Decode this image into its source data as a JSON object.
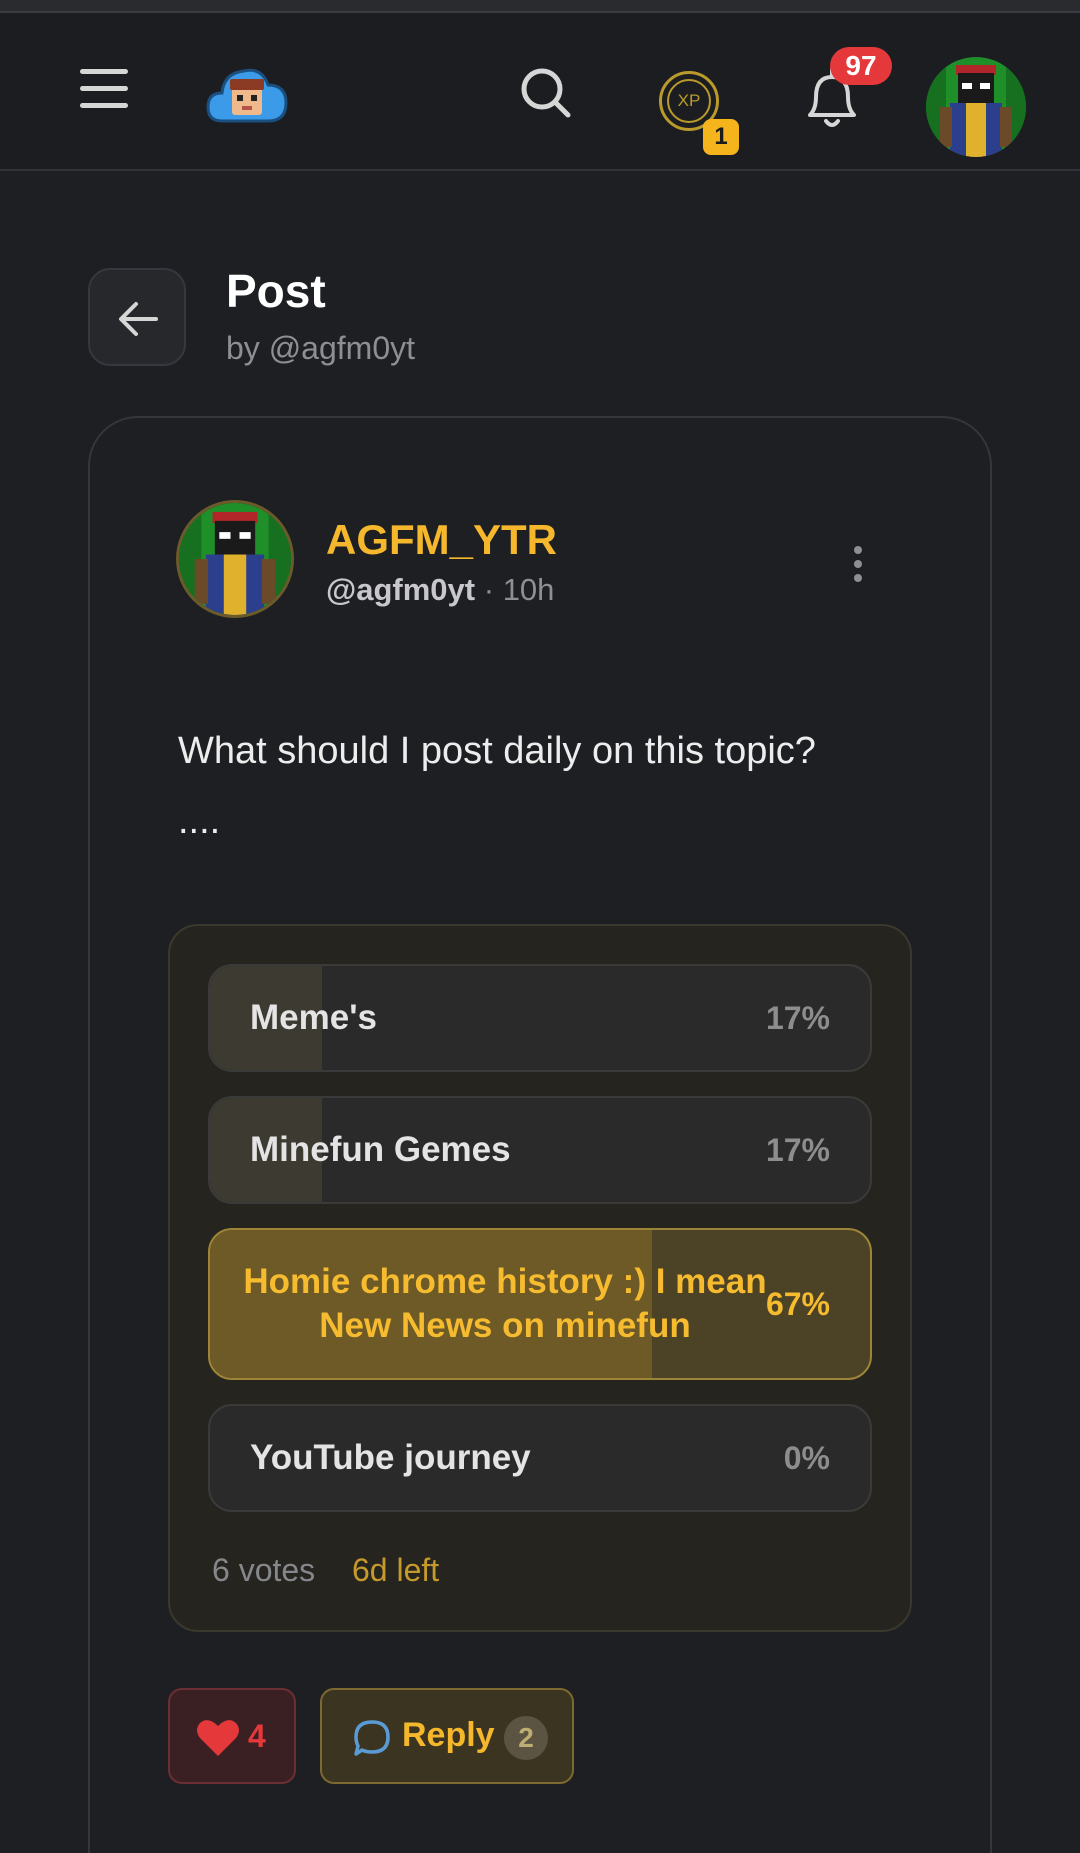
{
  "header": {
    "notifications_count": "97",
    "xp_label": "XP",
    "xp_count": "1"
  },
  "page": {
    "title": "Post",
    "subtitle": "by @agfm0yt"
  },
  "post": {
    "author_name": "AGFM_YTR",
    "author_handle": "@agfm0yt",
    "separator": "·",
    "time": "10h",
    "text_line1": "What should I post daily on this topic?",
    "text_line2": "...."
  },
  "poll": {
    "options": [
      {
        "label": "Meme's",
        "percent": "17%",
        "value": 17,
        "selected": false
      },
      {
        "label": "Minefun Gemes",
        "percent": "17%",
        "value": 17,
        "selected": false
      },
      {
        "label": "Homie chrome history :) I mean New News on minefun",
        "percent": "67%",
        "value": 67,
        "selected": true
      },
      {
        "label": "YouTube journey",
        "percent": "0%",
        "value": 0,
        "selected": false
      }
    ],
    "votes": "6 votes",
    "time_left": "6d left"
  },
  "actions": {
    "likes": "4",
    "reply_label": "Reply",
    "reply_count": "2"
  },
  "colors": {
    "accent": "#f5b72c",
    "background": "#1e1f23",
    "like": "#e5383b",
    "badge": "#e5383b"
  },
  "icons": [
    "menu-icon",
    "app-logo",
    "search-icon",
    "xp-icon",
    "bell-icon",
    "back-arrow-icon",
    "more-vertical-icon",
    "heart-icon",
    "comment-icon"
  ]
}
